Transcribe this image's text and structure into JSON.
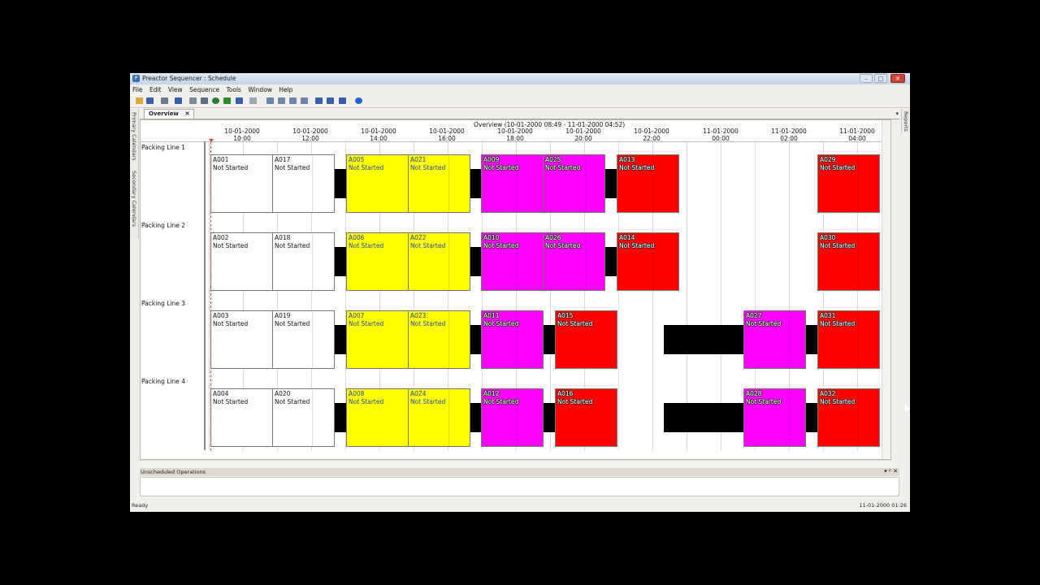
{
  "window": {
    "title": "Preactor Sequencer : Schedule",
    "buttons": [
      "–",
      "□",
      "✕"
    ]
  },
  "menu": [
    "File",
    "Edit",
    "View",
    "Sequence",
    "Tools",
    "Window",
    "Help"
  ],
  "tabs": {
    "active": "Overview",
    "close": "×"
  },
  "side_panels": {
    "left": [
      "Primary Calendars",
      "Secondary Calendars"
    ],
    "right": "Reports"
  },
  "overview": {
    "title": "Overview   (10-01-2000 08:49 - 11-01-2000 04:52)"
  },
  "time_axis": [
    {
      "date": "10-01-2000",
      "time": "10:00"
    },
    {
      "date": "10-01-2000",
      "time": "12:00"
    },
    {
      "date": "10-01-2000",
      "time": "14:00"
    },
    {
      "date": "10-01-2000",
      "time": "16:00"
    },
    {
      "date": "10-01-2000",
      "time": "18:00"
    },
    {
      "date": "10-01-2000",
      "time": "20:00"
    },
    {
      "date": "10-01-2000",
      "time": "22:00"
    },
    {
      "date": "11-01-2000",
      "time": "00:00"
    },
    {
      "date": "11-01-2000",
      "time": "02:00"
    },
    {
      "date": "11-01-2000",
      "time": "04:00"
    }
  ],
  "resources": [
    "Packing Line 1",
    "Packing Line 2",
    "Packing Line 3",
    "Packing Line 4"
  ],
  "status_label": "Not Started",
  "operations": {
    "row1": [
      "A001",
      "A017",
      "A005",
      "A021",
      "A009",
      "A025",
      "A013",
      "A029"
    ],
    "row2": [
      "A002",
      "A018",
      "A006",
      "A022",
      "A010",
      "A026",
      "A014",
      "A030"
    ],
    "row3": [
      "A003",
      "A019",
      "A007",
      "A023",
      "A011",
      "A015",
      "A027",
      "A031"
    ],
    "row4": [
      "A004",
      "A020",
      "A008",
      "A024",
      "A012",
      "A016",
      "A028",
      "A032"
    ]
  },
  "colors": {
    "white": "#ffffff",
    "yellow": "#ffff00",
    "magenta": "#ff00ff",
    "red": "#ff0000",
    "idle": "#000000"
  },
  "unscheduled": {
    "label": "Unscheduled Operations",
    "icons": "▾ ᵖ ✕"
  },
  "status_bar": {
    "left": "Ready",
    "right": "11-01-2000 01:26"
  }
}
